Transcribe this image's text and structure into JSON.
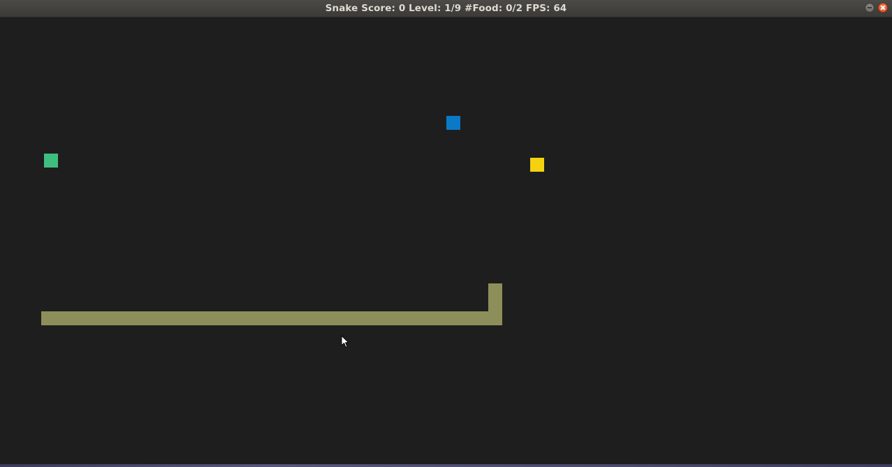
{
  "window": {
    "title": "Snake Score: 0 Level: 1/9 #Food: 0/2 FPS: 64",
    "controls": [
      "minimize-icon",
      "close-icon"
    ]
  },
  "game": {
    "score": 0,
    "level": "1/9",
    "food": "0/2",
    "fps": 64,
    "colors": {
      "background": "#1e1e1e",
      "snake": "#8c8f5a",
      "food_green": "#3fbf7f",
      "food_blue": "#0a7ac7",
      "food_yellow": "#f5d20f"
    },
    "food_items": [
      "green-square",
      "blue-square",
      "yellow-square"
    ]
  }
}
